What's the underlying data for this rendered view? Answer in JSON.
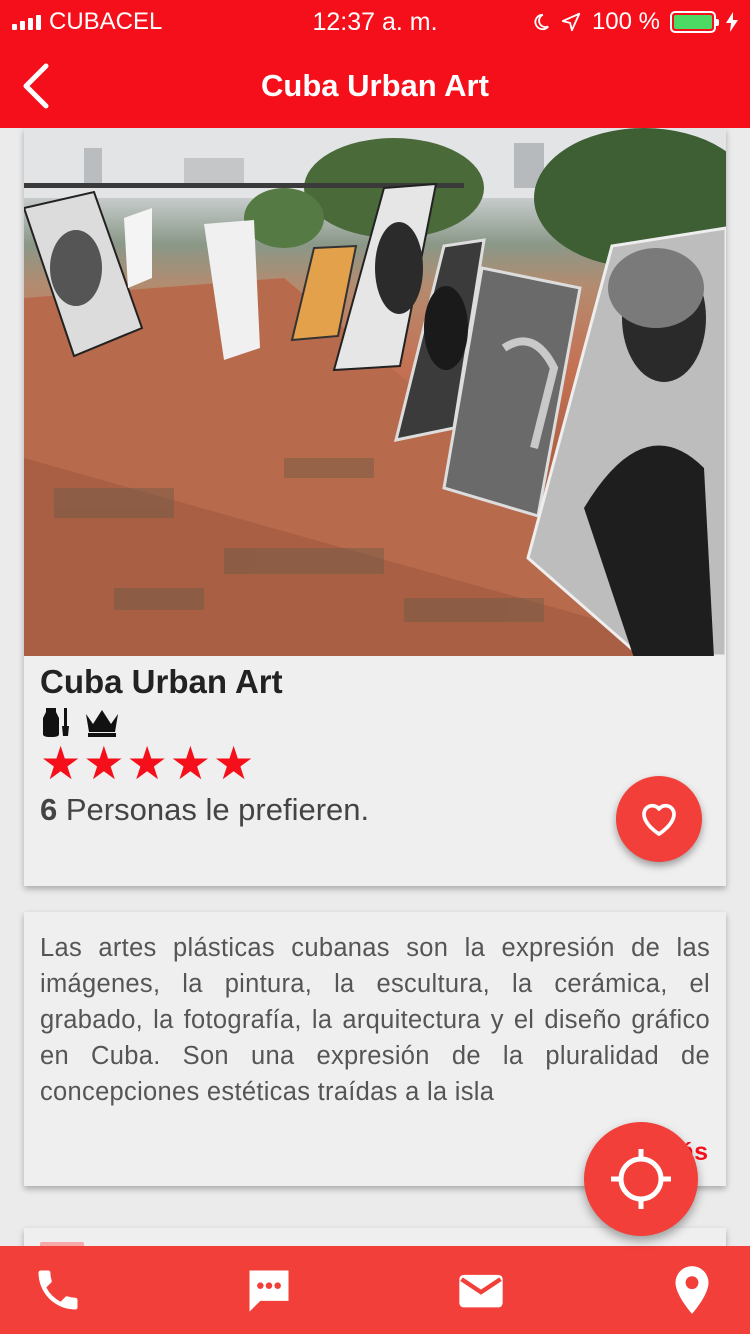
{
  "status_bar": {
    "carrier": "CUBACEL",
    "time": "12:37 a. m.",
    "battery": "100 %"
  },
  "app_bar": {
    "title": "Cuba Urban Art",
    "icons": {
      "back": "chevron-left-icon"
    }
  },
  "place": {
    "name": "Cuba Urban Art",
    "category_icons": [
      "vase-brush-icon",
      "crown-icon"
    ],
    "rating": 5,
    "stars": [
      "★",
      "★",
      "★",
      "★",
      "★"
    ],
    "prefer_count": "6",
    "prefer_text": " Personas le prefieren."
  },
  "description": {
    "text": "Las artes plásticas cubanas son la expresión de las imágenes, la pintura, la escultura, la cerámica, el grabado, la fotografía, la arquitectura y el diseño gráfico en Cuba. Son una expresión de la pluralidad de concepciones estéticas traídas a la isla",
    "more_label": "Más"
  },
  "bottom_nav": {
    "items": [
      "phone-icon",
      "chat-icon",
      "mail-icon",
      "location-pin-icon"
    ]
  },
  "colors": {
    "primary": "#f50f1b",
    "fab": "#f23f3a",
    "battery": "#4cd964"
  }
}
